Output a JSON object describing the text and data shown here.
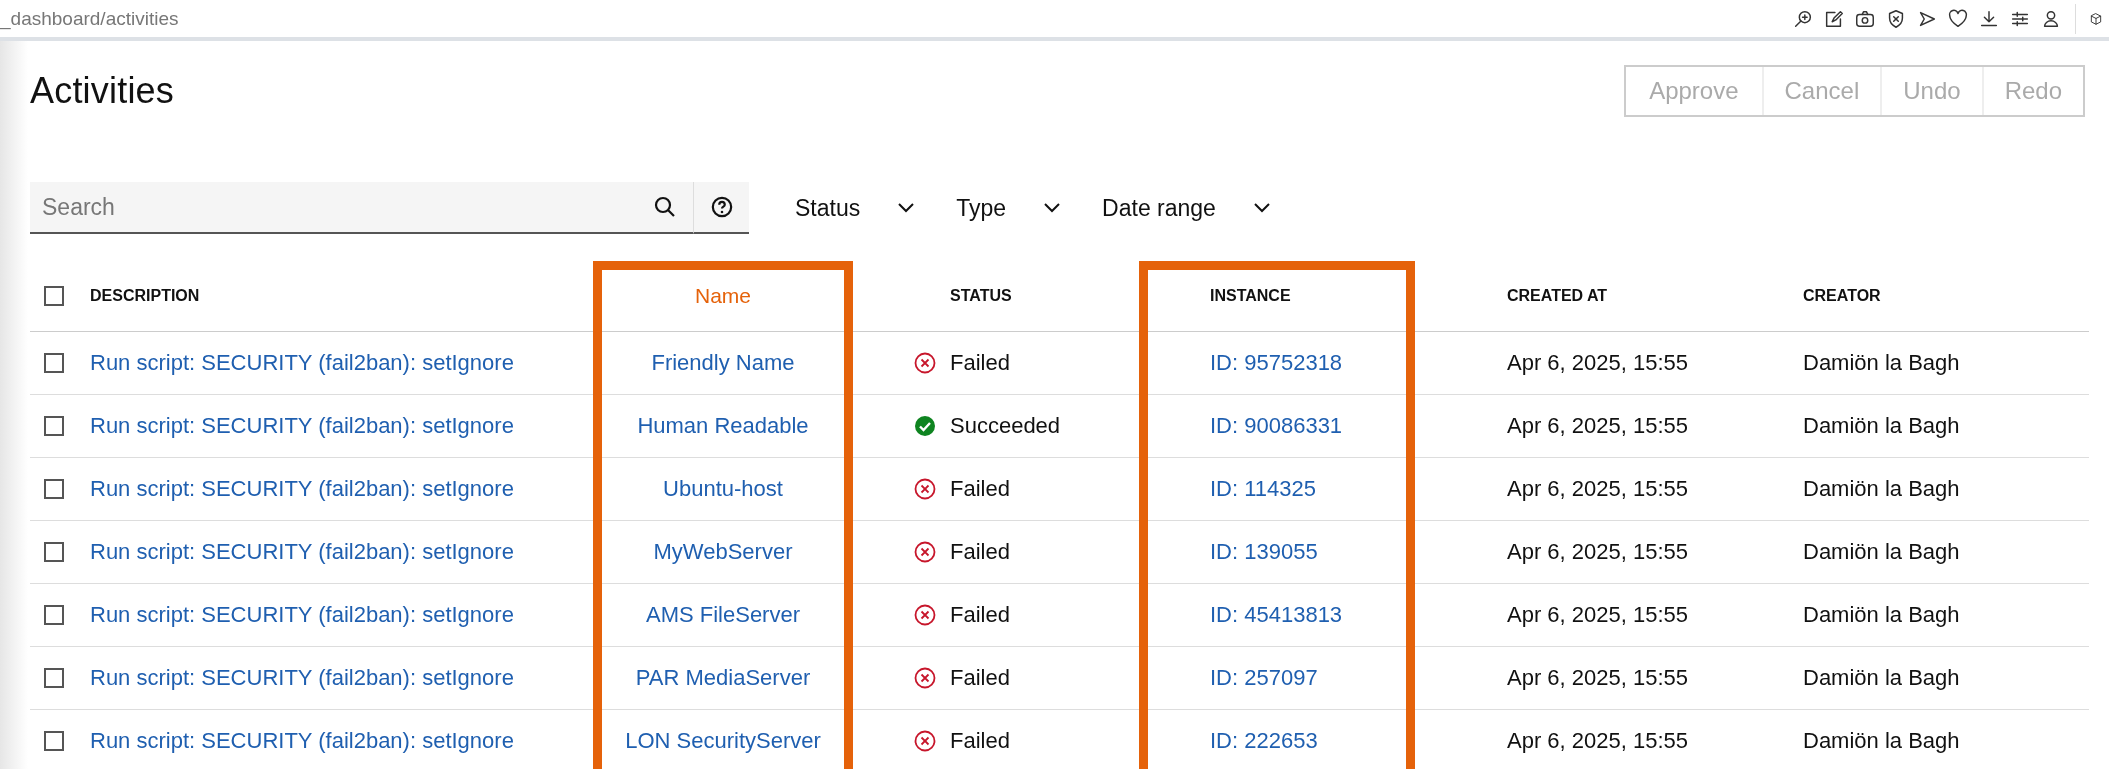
{
  "browser": {
    "url": "_dashboard/activities"
  },
  "page": {
    "title": "Activities"
  },
  "actions": [
    {
      "label": "Approve",
      "disabled": true
    },
    {
      "label": "Cancel",
      "disabled": true
    },
    {
      "label": "Undo",
      "disabled": true
    },
    {
      "label": "Redo",
      "disabled": true
    }
  ],
  "search": {
    "placeholder": "Search"
  },
  "filters": [
    {
      "label": "Status"
    },
    {
      "label": "Type"
    },
    {
      "label": "Date range"
    }
  ],
  "table": {
    "select_all": {
      "checked": false
    },
    "columns": [
      {
        "label": "DESCRIPTION",
        "highlighted": false,
        "emphasized": false
      },
      {
        "label": "Name",
        "highlighted": true,
        "emphasized": true
      },
      {
        "label": "STATUS",
        "highlighted": false,
        "emphasized": false
      },
      {
        "label": "INSTANCE",
        "highlighted": true,
        "emphasized": false
      },
      {
        "label": "CREATED AT",
        "highlighted": false,
        "emphasized": false
      },
      {
        "label": "CREATOR",
        "highlighted": false,
        "emphasized": false
      }
    ],
    "rows": [
      {
        "checked": false,
        "description": "Run script: SECURITY (fail2ban): setIgnore",
        "name": "Friendly Name",
        "status": {
          "kind": "failed",
          "label": "Failed"
        },
        "instance": "ID: 95752318",
        "created_at": "Apr 6, 2025, 15:55",
        "creator": "Damiön la Bagh"
      },
      {
        "checked": false,
        "description": "Run script: SECURITY (fail2ban): setIgnore",
        "name": "Human Readable",
        "status": {
          "kind": "succeeded",
          "label": "Succeeded"
        },
        "instance": "ID: 90086331",
        "created_at": "Apr 6, 2025, 15:55",
        "creator": "Damiön la Bagh"
      },
      {
        "checked": false,
        "description": "Run script: SECURITY (fail2ban): setIgnore",
        "name": "Ubuntu-host",
        "status": {
          "kind": "failed",
          "label": "Failed"
        },
        "instance": "ID: 114325",
        "created_at": "Apr 6, 2025, 15:55",
        "creator": "Damiön la Bagh"
      },
      {
        "checked": false,
        "description": "Run script: SECURITY (fail2ban): setIgnore",
        "name": "MyWebServer",
        "status": {
          "kind": "failed",
          "label": "Failed"
        },
        "instance": "ID: 139055",
        "created_at": "Apr 6, 2025, 15:55",
        "creator": "Damiön la Bagh"
      },
      {
        "checked": false,
        "description": "Run script: SECURITY (fail2ban): setIgnore",
        "name": "AMS FileServer",
        "status": {
          "kind": "failed",
          "label": "Failed"
        },
        "instance": "ID: 45413813",
        "created_at": "Apr 6, 2025, 15:55",
        "creator": "Damiön la Bagh"
      },
      {
        "checked": false,
        "description": "Run script: SECURITY (fail2ban): setIgnore",
        "name": "PAR MediaServer",
        "status": {
          "kind": "failed",
          "label": "Failed"
        },
        "instance": "ID: 257097",
        "created_at": "Apr 6, 2025, 15:55",
        "creator": "Damiön la Bagh"
      },
      {
        "checked": false,
        "description": "Run script: SECURITY (fail2ban): setIgnore",
        "name": "LON SecurityServer",
        "status": {
          "kind": "failed",
          "label": "Failed"
        },
        "instance": "ID: 222653",
        "created_at": "Apr 6, 2025, 15:55",
        "creator": "Damiön la Bagh"
      }
    ]
  }
}
